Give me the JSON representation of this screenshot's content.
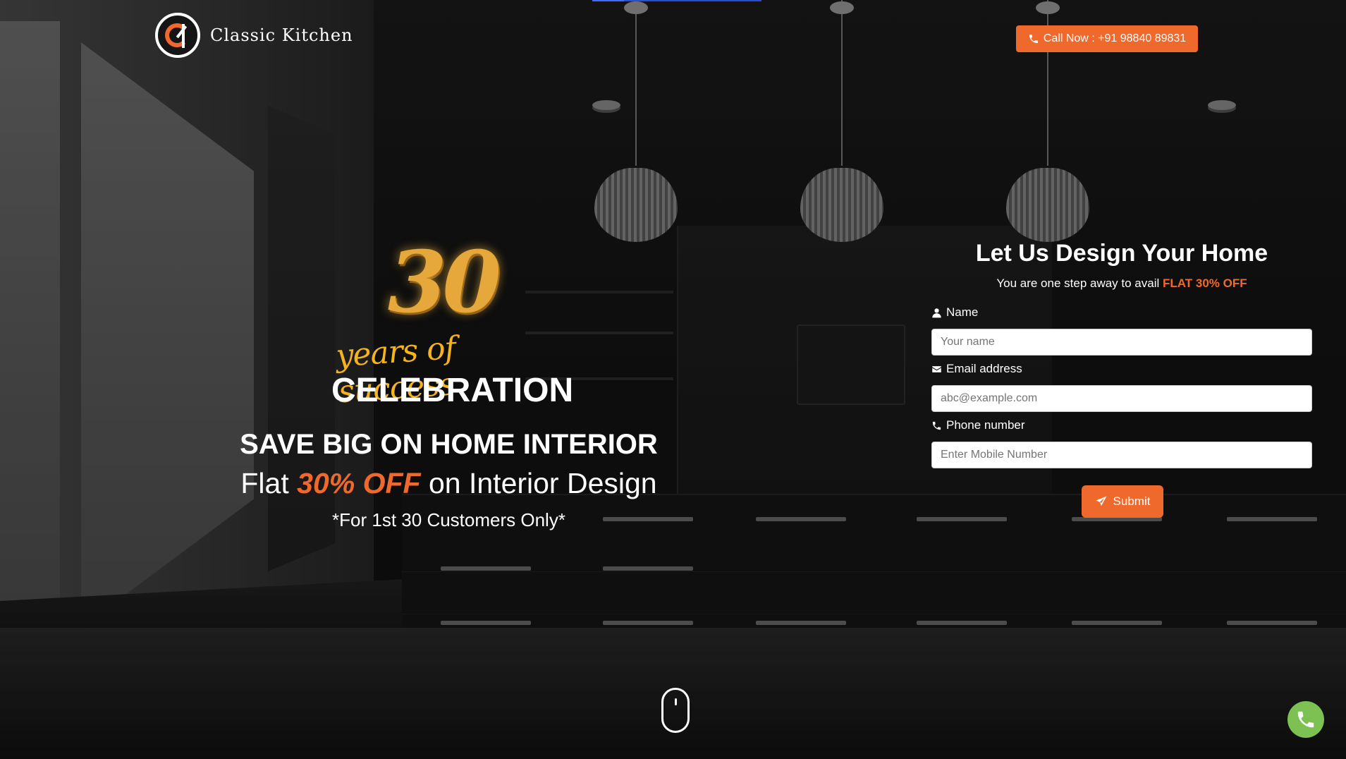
{
  "brand": {
    "name": "Classic Kitchen"
  },
  "header": {
    "call_label": "Call Now : +91 98840 89831"
  },
  "hero": {
    "badge_number": "30",
    "badge_script": "years of success",
    "badge_title": "CELEBRATION",
    "headline": "SAVE BIG ON HOME INTERIOR",
    "offer_prefix": "Flat",
    "offer_accent": "30% OFF",
    "offer_suffix": "on Interior Design",
    "note": "*For 1st 30 Customers Only*"
  },
  "form": {
    "title": "Let Us Design Your Home",
    "subtitle_prefix": "You are one step away to avail",
    "subtitle_accent": "FLAT 30% OFF",
    "name_label": "Name",
    "name_placeholder": "Your name",
    "email_label": "Email address",
    "email_placeholder": "abc@example.com",
    "phone_label": "Phone number",
    "phone_placeholder": "Enter Mobile Number",
    "submit_label": "Submit"
  },
  "colors": {
    "accent": "#f0692c",
    "gold": "#e7a83b",
    "whatsapp_green": "#7cc152"
  },
  "icons": {
    "call": "phone-icon",
    "name": "user-icon",
    "email": "envelope-icon",
    "phone": "phone-icon",
    "submit": "paper-plane-icon",
    "scroll": "mouse-scroll-icon",
    "fab": "phone-icon"
  }
}
